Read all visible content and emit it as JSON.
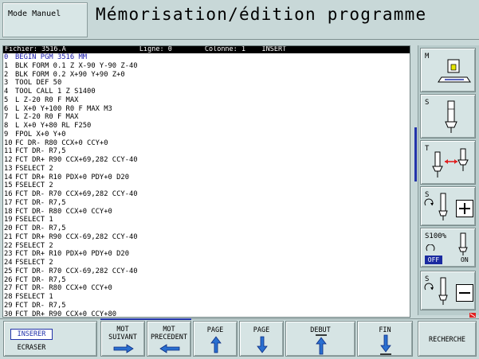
{
  "header": {
    "mode": "Mode Manuel",
    "title": "Mémorisation/édition programme"
  },
  "program": {
    "info": {
      "file_label": "Fichier:",
      "file": "3516.A",
      "line_label": "Ligne:",
      "line": "0",
      "column_label": "Colonne:",
      "column": "1",
      "mode": "INSERT"
    },
    "lines": [
      {
        "n": "0",
        "text": "BEGIN PGM 3516 MM"
      },
      {
        "n": "1",
        "text": "BLK FORM 0.1 Z X-90 Y-90 Z-40"
      },
      {
        "n": "2",
        "text": "BLK FORM 0.2 X+90 Y+90 Z+0"
      },
      {
        "n": "3",
        "text": "TOOL DEF 50"
      },
      {
        "n": "4",
        "text": "TOOL CALL 1 Z S1400"
      },
      {
        "n": "5",
        "text": "L Z-20 R0 F MAX"
      },
      {
        "n": "6",
        "text": "L X+0 Y+100 R0 F MAX M3"
      },
      {
        "n": "7",
        "text": "L Z-20 R0 F MAX"
      },
      {
        "n": "8",
        "text": "L X+0 Y+80 RL F250"
      },
      {
        "n": "9",
        "text": "FPOL X+0 Y+0"
      },
      {
        "n": "10",
        "text": "FC DR- R80 CCX+0 CCY+0"
      },
      {
        "n": "11",
        "text": "FCT DR- R7,5"
      },
      {
        "n": "12",
        "text": "FCT DR+ R90 CCX+69,282 CCY-40"
      },
      {
        "n": "13",
        "text": "FSELECT 2"
      },
      {
        "n": "14",
        "text": "FCT DR+ R10 PDX+0 PDY+0 D20"
      },
      {
        "n": "15",
        "text": "FSELECT 2"
      },
      {
        "n": "16",
        "text": "FCT DR- R70 CCX+69,282 CCY-40"
      },
      {
        "n": "17",
        "text": "FCT DR- R7,5"
      },
      {
        "n": "18",
        "text": "FCT DR- R80 CCX+0 CCY+0"
      },
      {
        "n": "19",
        "text": "FSELECT 1"
      },
      {
        "n": "20",
        "text": "FCT DR- R7,5"
      },
      {
        "n": "21",
        "text": "FCT DR+ R90 CCX-69,282 CCY-40"
      },
      {
        "n": "22",
        "text": "FSELECT 2"
      },
      {
        "n": "23",
        "text": "FCT DR+ R10 PDX+0 PDY+0 D20"
      },
      {
        "n": "24",
        "text": "FSELECT 2"
      },
      {
        "n": "25",
        "text": "FCT DR- R70 CCX-69,282 CCY-40"
      },
      {
        "n": "26",
        "text": "FCT DR- R7,5"
      },
      {
        "n": "27",
        "text": "FCT DR- R80 CCX+0 CCY+0"
      },
      {
        "n": "28",
        "text": "FSELECT 1"
      },
      {
        "n": "29",
        "text": "FCT DR- R7,5"
      },
      {
        "n": "30",
        "text": "FCT DR+ R90 CCX+0 CCY+80"
      }
    ]
  },
  "side": {
    "m": "M",
    "s1": "S",
    "t": "T",
    "s_plus": "S",
    "s100": "S100%",
    "off": "OFF",
    "on": "ON",
    "s_minus": "S"
  },
  "softkeys": {
    "insert": "INSERER",
    "overwrite": "ECRASER",
    "next_word_1": "MOT",
    "next_word_2": "SUIVANT",
    "prev_word_1": "MOT",
    "prev_word_2": "PRECEDENT",
    "page_up": "PAGE",
    "page_down": "PAGE",
    "begin": "DEBUT",
    "end": "FIN",
    "search": "RECHERCHE"
  },
  "colors": {
    "background": "#c8d8d8",
    "accent": "#2233aa",
    "highlight": "#1515a8",
    "alert": "#e02020"
  }
}
